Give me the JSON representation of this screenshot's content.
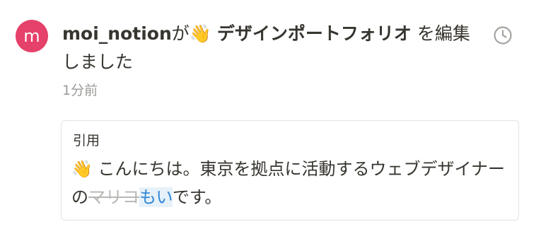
{
  "activity": {
    "avatar_letter": "m",
    "avatar_color": "#e5416a",
    "user": "moi_notion",
    "particle": "が",
    "page_emoji": "👋",
    "page_title": "デザインポートフォリオ",
    "action": " を編集しました",
    "timestamp": "1分前",
    "clock_icon": "clock-icon"
  },
  "quote": {
    "label": "引用",
    "emoji": "👋",
    "text_before": " こんにちは。東京を拠点に活動するウェブデザイナーの",
    "deleted": "マリコ",
    "inserted": "もい",
    "text_after": "です。",
    "deleted_color": "#b8b7b4",
    "inserted_color": "#2f87d6",
    "inserted_bg": "#e7f1f9"
  }
}
